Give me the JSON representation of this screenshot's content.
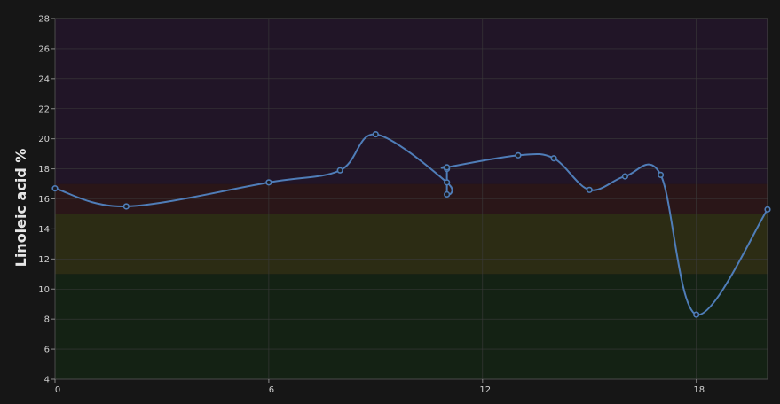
{
  "chart_data": {
    "type": "line",
    "xlabel": "",
    "ylabel": "Linoleic acid %",
    "xlim": [
      0,
      20
    ],
    "ylim": [
      4,
      28
    ],
    "x_ticks": [
      0,
      6,
      12,
      18
    ],
    "y_ticks": [
      4,
      6,
      8,
      10,
      12,
      14,
      16,
      18,
      20,
      22,
      24,
      26,
      28
    ],
    "grid": true,
    "legend": "none",
    "bands": [
      {
        "from": 4,
        "to": 11,
        "color": "#142214"
      },
      {
        "from": 11,
        "to": 15,
        "color": "#2c2c14"
      },
      {
        "from": 15,
        "to": 17,
        "color": "#2a1618"
      },
      {
        "from": 17,
        "to": 28,
        "color": "#211527"
      }
    ],
    "series": [
      {
        "color": "#4f7db8",
        "points": [
          {
            "x": 0,
            "y": 16.7
          },
          {
            "x": 2,
            "y": 15.5
          },
          {
            "x": 6,
            "y": 17.1
          },
          {
            "x": 8,
            "y": 17.9
          },
          {
            "x": 9,
            "y": 20.3
          },
          {
            "x": 11,
            "y": 17.1
          },
          {
            "x": 11,
            "y": 16.3
          },
          {
            "x": 11,
            "y": 18.0
          },
          {
            "x": 11,
            "y": 18.1
          },
          {
            "x": 13,
            "y": 18.9
          },
          {
            "x": 14,
            "y": 18.7
          },
          {
            "x": 15,
            "y": 16.6
          },
          {
            "x": 16,
            "y": 17.5
          },
          {
            "x": 17,
            "y": 17.6
          },
          {
            "x": 18,
            "y": 8.3
          },
          {
            "x": 20,
            "y": 15.3
          }
        ]
      }
    ]
  }
}
